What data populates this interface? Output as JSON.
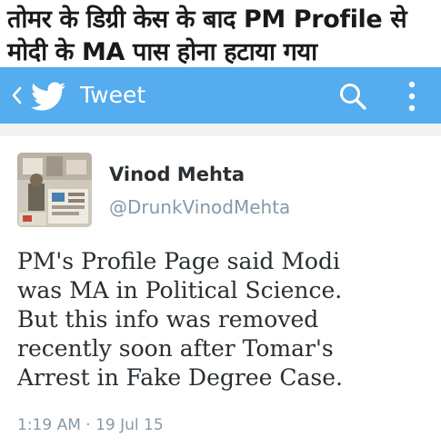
{
  "headline": {
    "line1": "तोमर के डिग्री केस के बाद PM Profile से",
    "line2": "मोदी के MA पास होना हटाया गया"
  },
  "toolbar": {
    "title": "Tweet",
    "icons": [
      "back-icon",
      "twitter-bird-icon",
      "search-icon",
      "more-icon"
    ],
    "color": "#55acee"
  },
  "tweet": {
    "display_name": "Vinod Mehta",
    "handle": "@DrunkVinodMehta",
    "text_lines": [
      "PM's Profile Page said Modi",
      "was MA in Political Science.",
      "But this info was removed",
      "recently soon after Tomar's",
      "Arrest in Fake Degree Case."
    ],
    "timestamp": "1:19 AM · 19 Jul 15"
  }
}
